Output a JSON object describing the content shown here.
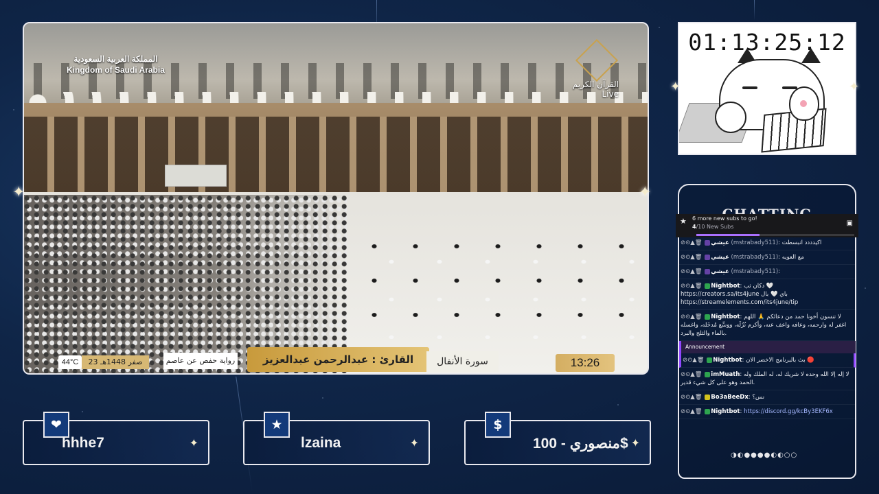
{
  "stream": {
    "video": {
      "country_ar": "المملكة العربية السعودية",
      "country_en": "Kingdom of Saudi Arabia",
      "channel_ar": "القرآن الكريم",
      "channel_status": "Live",
      "temperature": "44°C",
      "hijri_date": "23 صفر 1448هـ",
      "riwaya": "رواية حفص عن عاصم",
      "reader": "القارئ : عبدالرحمن عبدالعزيز السديس",
      "surah": "سورة الأنفال",
      "clock": "13:26"
    },
    "timer": "01:13:25:12"
  },
  "chat": {
    "title": "CHATTING",
    "goal": {
      "text": "6 more new subs to go!",
      "progress_current": "4",
      "progress_label": "/10 New Subs",
      "progress_fraction": 0.4
    },
    "messages": [
      {
        "user": "عيشي",
        "handle": "(mstrabady511)",
        "text": "اكيدددد انبسطت",
        "badge_color": "#6441a5"
      },
      {
        "user": "عيشي",
        "handle": "(mstrabady511)",
        "text": "مع العويه",
        "badge_color": "#6441a5"
      },
      {
        "user": "عيشي",
        "handle": "(mstrabady511)",
        "text": "",
        "badge_color": "#6441a5"
      },
      {
        "user": "Nightbot",
        "handle": "",
        "text": "دكان ثب 🤍 https://creators.sa/its4june باي 🤍 بال https://streamelements.com/its4june/tip",
        "badge_color": "#2ea44f"
      },
      {
        "user": "Nightbot",
        "handle": "",
        "text": "لا تنسون أخونا حمد من دعائكم 🙏 اللهم اغفر له وارحمه، وعافه واعف عنه، وأكرم نُزُلَه، ووسِّع مُدخَله، واغسله بالماء والثلج والبرد.",
        "badge_color": "#2ea44f"
      },
      {
        "user": "Nightbot",
        "handle": "",
        "text": "بث بالبرنامج الاخضر الان 🔴",
        "badge_color": "#2ea44f",
        "announcement": "Announcement"
      },
      {
        "user": "imMuath",
        "handle": "",
        "text": "لا إله إلا الله وحده لا شريك له، له الملك وله الحمد وهو على كل شيء قدير.",
        "badge_color": "#2ea44f"
      },
      {
        "user": "Bo3aBeeDx",
        "handle": "",
        "text": "نس؟",
        "badge_color": "#d1c21d"
      },
      {
        "user": "Nightbot",
        "handle": "",
        "text": "https://discord.gg/kcBy3EKF6x",
        "badge_color": "#2ea44f"
      }
    ],
    "moon_phases": "◑◐●●●●◐◐○○"
  },
  "alerts": [
    {
      "icon": "heart-icon",
      "glyph": "❤",
      "name": "hhhe7"
    },
    {
      "icon": "star-icon",
      "glyph": "★",
      "name": "lzaina"
    },
    {
      "icon": "dollar-icon",
      "glyph": "$",
      "name": "منصوري - 100$"
    }
  ]
}
